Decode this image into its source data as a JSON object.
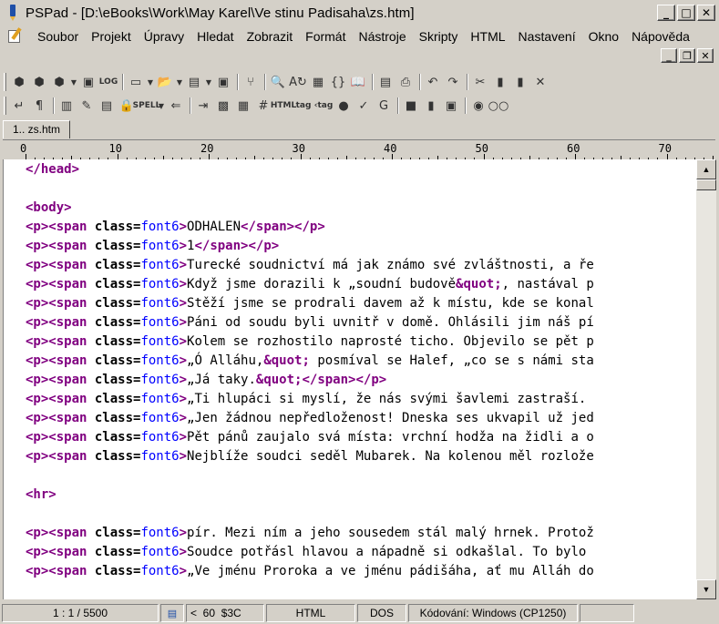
{
  "window": {
    "title": "PSPad - [D:\\eBooks\\Work\\May Karel\\Ve stinu Padisaha\\zs.htm]",
    "min_glyph": "_",
    "max_glyph": "□",
    "close_glyph": "✕",
    "mdi_min_glyph": "_",
    "mdi_restore_glyph": "❐",
    "mdi_close_glyph": "✕"
  },
  "menu": [
    "Soubor",
    "Projekt",
    "Úpravy",
    "Hledat",
    "Zobrazit",
    "Formát",
    "Nástroje",
    "Skripty",
    "HTML",
    "Nastavení",
    "Okno",
    "Nápověda"
  ],
  "toolbar1": [
    {
      "icon": "project-icon",
      "glyph": "⬢"
    },
    {
      "icon": "open-project-icon",
      "glyph": "⬢"
    },
    {
      "icon": "save-project-icon",
      "glyph": "⬢"
    },
    {
      "icon": "dropdown-icon",
      "glyph": "▼"
    },
    {
      "icon": "close-project-icon",
      "glyph": "▣"
    },
    {
      "icon": "log-icon",
      "glyph": "LOG"
    },
    {
      "icon": "new-file-icon",
      "glyph": "▭"
    },
    {
      "icon": "dropdown-icon",
      "glyph": "▼"
    },
    {
      "icon": "open-folder-icon",
      "glyph": "📂"
    },
    {
      "icon": "dropdown-icon",
      "glyph": "▼"
    },
    {
      "icon": "save-icon",
      "glyph": "▤"
    },
    {
      "icon": "dropdown-icon",
      "glyph": "▼"
    },
    {
      "icon": "save-all-icon",
      "glyph": "▣"
    },
    {
      "icon": "tree-icon",
      "glyph": "⑂"
    },
    {
      "icon": "search-icon",
      "glyph": "🔍"
    },
    {
      "icon": "replace-icon",
      "glyph": "A↻"
    },
    {
      "icon": "web-icon",
      "glyph": "▦"
    },
    {
      "icon": "braces-icon",
      "glyph": "{}"
    },
    {
      "icon": "book-icon",
      "glyph": "📖"
    },
    {
      "icon": "preview-icon",
      "glyph": "▤"
    },
    {
      "icon": "print-icon",
      "glyph": "⎙"
    },
    {
      "icon": "undo-icon",
      "glyph": "↶"
    },
    {
      "icon": "redo-icon",
      "glyph": "↷"
    },
    {
      "icon": "cut-icon",
      "glyph": "✂"
    },
    {
      "icon": "copy-icon",
      "glyph": "▮"
    },
    {
      "icon": "paste-icon",
      "glyph": "▮"
    },
    {
      "icon": "delete-icon",
      "glyph": "✕"
    }
  ],
  "toolbar2": [
    {
      "icon": "wrap-icon",
      "glyph": "↵"
    },
    {
      "icon": "pilcrow-icon",
      "glyph": "¶"
    },
    {
      "icon": "column-icon",
      "glyph": "▥"
    },
    {
      "icon": "highlighter-icon",
      "glyph": "✎"
    },
    {
      "icon": "hex-icon",
      "glyph": "▤"
    },
    {
      "icon": "lock-icon",
      "glyph": "🔒"
    },
    {
      "icon": "spell-icon",
      "glyph": "SPELL"
    },
    {
      "icon": "dropdown-icon",
      "glyph": "▼"
    },
    {
      "icon": "bookmark-icon",
      "glyph": "⇐"
    },
    {
      "icon": "indent-icon",
      "glyph": "⇥"
    },
    {
      "icon": "package-icon",
      "glyph": "▩"
    },
    {
      "icon": "color-icon",
      "glyph": "▦"
    },
    {
      "icon": "hash-icon",
      "glyph": "#"
    },
    {
      "icon": "html-txt-icon",
      "glyph": "HTML"
    },
    {
      "icon": "tag-icon",
      "glyph": "tag"
    },
    {
      "icon": "untag-icon",
      "glyph": "‹tag"
    },
    {
      "icon": "globe-icon",
      "glyph": "●"
    },
    {
      "icon": "validate-icon",
      "glyph": "✓"
    },
    {
      "icon": "google-icon",
      "glyph": "G"
    },
    {
      "icon": "block-icon",
      "glyph": "■"
    },
    {
      "icon": "document-icon",
      "glyph": "▮"
    },
    {
      "icon": "window-icon",
      "glyph": "▣"
    },
    {
      "icon": "record-icon",
      "glyph": "◉"
    },
    {
      "icon": "glasses-icon",
      "glyph": "○○"
    }
  ],
  "tabs": [
    "1.. zs.htm"
  ],
  "ruler": {
    "marks": [
      "0",
      "10",
      "20",
      "30",
      "40",
      "50",
      "60",
      "70"
    ]
  },
  "code_lines": [
    [
      {
        "t": "tag",
        "s": "</head>"
      }
    ],
    [],
    [
      {
        "t": "tag",
        "s": "<body>"
      }
    ],
    [
      {
        "t": "tag",
        "s": "<p><span "
      },
      {
        "t": "attr",
        "s": "class="
      },
      {
        "t": "val",
        "s": "font6"
      },
      {
        "t": "tag",
        "s": ">"
      },
      {
        "t": "txt",
        "s": "ODHALEN"
      },
      {
        "t": "tag",
        "s": "</span></p>"
      }
    ],
    [
      {
        "t": "tag",
        "s": "<p><span "
      },
      {
        "t": "attr",
        "s": "class="
      },
      {
        "t": "val",
        "s": "font6"
      },
      {
        "t": "tag",
        "s": ">"
      },
      {
        "t": "txt",
        "s": "1"
      },
      {
        "t": "tag",
        "s": "</span></p>"
      }
    ],
    [
      {
        "t": "tag",
        "s": "<p><span "
      },
      {
        "t": "attr",
        "s": "class="
      },
      {
        "t": "val",
        "s": "font6"
      },
      {
        "t": "tag",
        "s": ">"
      },
      {
        "t": "txt",
        "s": "Turecké soudnictví má jak známo své zvláštnosti, a ře"
      }
    ],
    [
      {
        "t": "tag",
        "s": "<p><span "
      },
      {
        "t": "attr",
        "s": "class="
      },
      {
        "t": "val",
        "s": "font6"
      },
      {
        "t": "tag",
        "s": ">"
      },
      {
        "t": "txt",
        "s": "Když jsme dorazili k „soudní budově"
      },
      {
        "t": "ent",
        "s": "&quot;"
      },
      {
        "t": "txt",
        "s": ", nastával p"
      }
    ],
    [
      {
        "t": "tag",
        "s": "<p><span "
      },
      {
        "t": "attr",
        "s": "class="
      },
      {
        "t": "val",
        "s": "font6"
      },
      {
        "t": "tag",
        "s": ">"
      },
      {
        "t": "txt",
        "s": "Stěží jsme se prodrali davem až k místu, kde se konal"
      }
    ],
    [
      {
        "t": "tag",
        "s": "<p><span "
      },
      {
        "t": "attr",
        "s": "class="
      },
      {
        "t": "val",
        "s": "font6"
      },
      {
        "t": "tag",
        "s": ">"
      },
      {
        "t": "txt",
        "s": "Páni od soudu byli uvnitř v domě. Ohlásili jim náš pí"
      }
    ],
    [
      {
        "t": "tag",
        "s": "<p><span "
      },
      {
        "t": "attr",
        "s": "class="
      },
      {
        "t": "val",
        "s": "font6"
      },
      {
        "t": "tag",
        "s": ">"
      },
      {
        "t": "txt",
        "s": "Kolem se rozhostilo naprosté ticho. Objevilo se pět p"
      }
    ],
    [
      {
        "t": "tag",
        "s": "<p><span "
      },
      {
        "t": "attr",
        "s": "class="
      },
      {
        "t": "val",
        "s": "font6"
      },
      {
        "t": "tag",
        "s": ">"
      },
      {
        "t": "txt",
        "s": "„Ó Alláhu,"
      },
      {
        "t": "ent",
        "s": "&quot;"
      },
      {
        "t": "txt",
        "s": " posmíval se Halef, „co se s námi sta"
      }
    ],
    [
      {
        "t": "tag",
        "s": "<p><span "
      },
      {
        "t": "attr",
        "s": "class="
      },
      {
        "t": "val",
        "s": "font6"
      },
      {
        "t": "tag",
        "s": ">"
      },
      {
        "t": "txt",
        "s": "„Já taky."
      },
      {
        "t": "ent",
        "s": "&quot;"
      },
      {
        "t": "tag",
        "s": "</span></p>"
      }
    ],
    [
      {
        "t": "tag",
        "s": "<p><span "
      },
      {
        "t": "attr",
        "s": "class="
      },
      {
        "t": "val",
        "s": "font6"
      },
      {
        "t": "tag",
        "s": ">"
      },
      {
        "t": "txt",
        "s": "„Ti hlupáci si myslí, že nás svými šavlemi zastraší."
      }
    ],
    [
      {
        "t": "tag",
        "s": "<p><span "
      },
      {
        "t": "attr",
        "s": "class="
      },
      {
        "t": "val",
        "s": "font6"
      },
      {
        "t": "tag",
        "s": ">"
      },
      {
        "t": "txt",
        "s": "„Jen žádnou nepředloženost! Dneska ses ukvapil už jed"
      }
    ],
    [
      {
        "t": "tag",
        "s": "<p><span "
      },
      {
        "t": "attr",
        "s": "class="
      },
      {
        "t": "val",
        "s": "font6"
      },
      {
        "t": "tag",
        "s": ">"
      },
      {
        "t": "txt",
        "s": "Pět pánů zaujalo svá místa: vrchní hodža na židli a o"
      }
    ],
    [
      {
        "t": "tag",
        "s": "<p><span "
      },
      {
        "t": "attr",
        "s": "class="
      },
      {
        "t": "val",
        "s": "font6"
      },
      {
        "t": "tag",
        "s": ">"
      },
      {
        "t": "txt",
        "s": "Nejblíže soudci seděl Mubarek. Na kolenou měl rozlože"
      }
    ],
    [],
    [
      {
        "t": "tag",
        "s": "<hr>"
      }
    ],
    [],
    [
      {
        "t": "tag",
        "s": "<p><span "
      },
      {
        "t": "attr",
        "s": "class="
      },
      {
        "t": "val",
        "s": "font6"
      },
      {
        "t": "tag",
        "s": ">"
      },
      {
        "t": "txt",
        "s": "pír. Mezi ním a jeho sousedem stál malý hrnek. Protož"
      }
    ],
    [
      {
        "t": "tag",
        "s": "<p><span "
      },
      {
        "t": "attr",
        "s": "class="
      },
      {
        "t": "val",
        "s": "font6"
      },
      {
        "t": "tag",
        "s": ">"
      },
      {
        "t": "txt",
        "s": "Soudce potřásl hlavou a nápadně si odkašlal. To bylo"
      }
    ],
    [
      {
        "t": "tag",
        "s": "<p><span "
      },
      {
        "t": "attr",
        "s": "class="
      },
      {
        "t": "val",
        "s": "font6"
      },
      {
        "t": "tag",
        "s": ">"
      },
      {
        "t": "txt",
        "s": "„Ve jménu Proroka a ve jménu pádišáha, ať mu Alláh do"
      }
    ]
  ],
  "scrollbar": {
    "up_glyph": "▲",
    "down_glyph": "▼"
  },
  "status": {
    "position": "1 : 1 / 5500",
    "char_info": "<  60  $3C",
    "mode": "HTML",
    "line_end": "DOS",
    "encoding": "Kódování: Windows (CP1250)"
  },
  "colors": {
    "tag": "#800080",
    "value": "#0000ff",
    "chrome": "#d4d0c8"
  }
}
